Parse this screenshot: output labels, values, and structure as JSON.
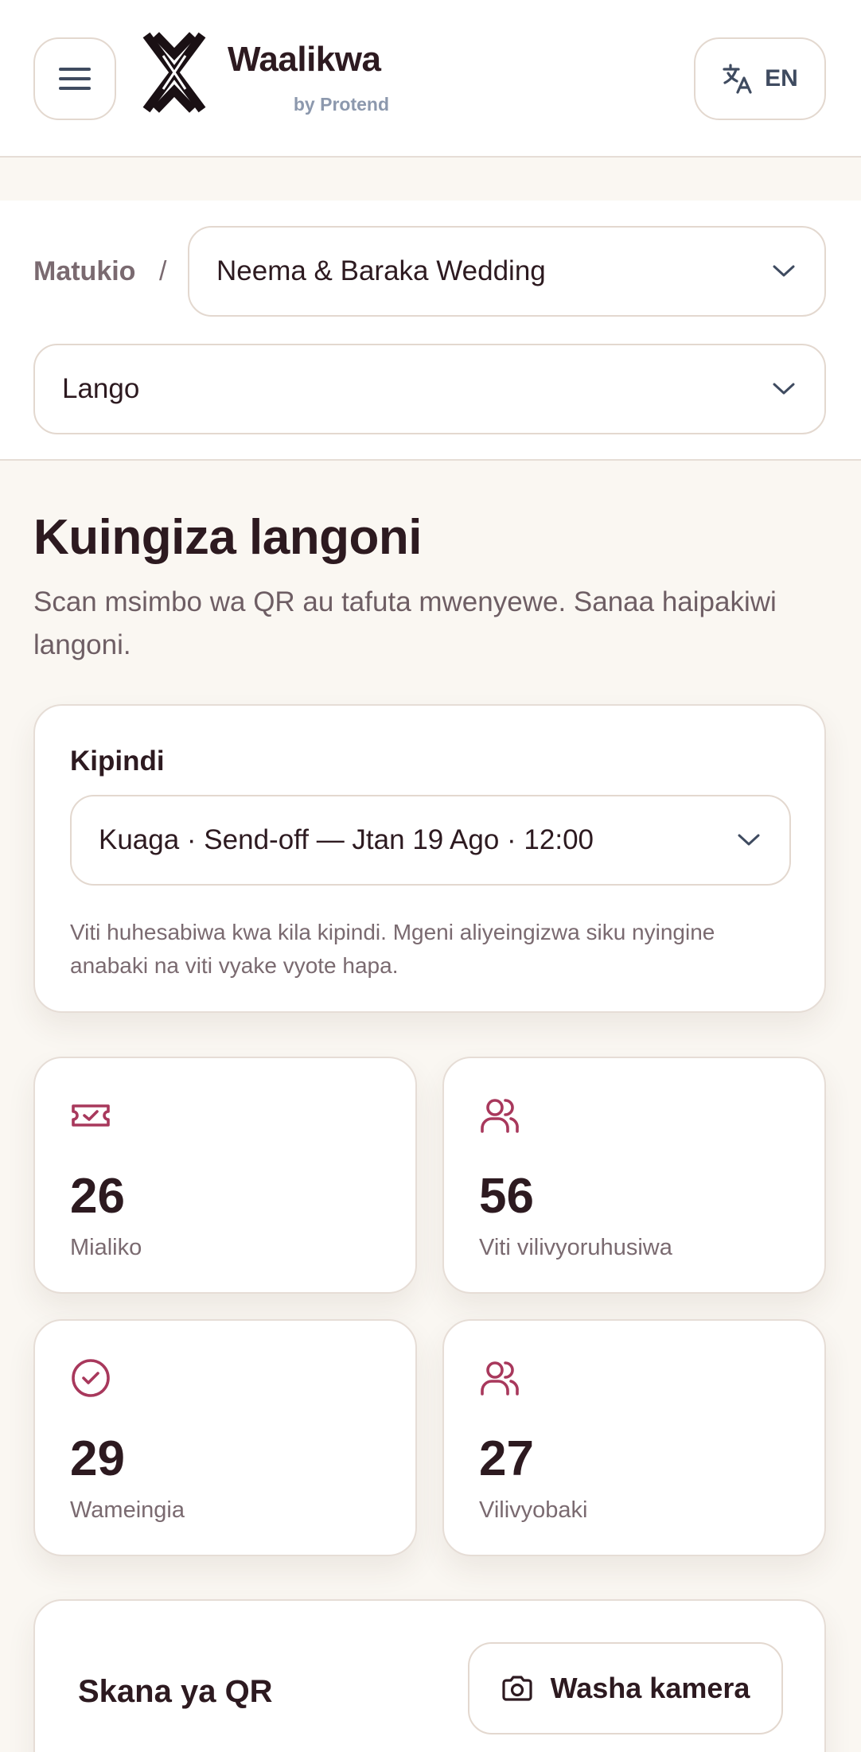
{
  "header": {
    "brand_name": "Waalikwa",
    "brand_by": "by Protend",
    "language": "EN"
  },
  "breadcrumb": {
    "root": "Matukio",
    "separator": "/"
  },
  "selectors": {
    "event": "Neema & Baraka Wedding",
    "gate": "Lango"
  },
  "page": {
    "title": "Kuingiza langoni",
    "subtitle": "Scan msimbo wa QR au tafuta mwenyewe. Sanaa haipakiwi langoni."
  },
  "session": {
    "label": "Kipindi",
    "selected": "Kuaga · Send-off — Jtan 19 Ago · 12:00",
    "note": "Viti huhesabiwa kwa kila kipindi. Mgeni aliyeingizwa siku nyingine anabaki na viti vyake vyote hapa."
  },
  "stats": [
    {
      "icon": "ticket-check-icon",
      "value": "26",
      "label": "Mialiko"
    },
    {
      "icon": "users-icon",
      "value": "56",
      "label": "Viti vilivyoruhusiwa"
    },
    {
      "icon": "check-circle-icon",
      "value": "29",
      "label": "Wameingia"
    },
    {
      "icon": "users-icon",
      "value": "27",
      "label": "Vilivyobaki"
    }
  ],
  "qr": {
    "title": "Skana ya QR",
    "camera_button": "Washa kamera"
  },
  "colors": {
    "accent": "#a8385c",
    "background": "#faf7f2",
    "text": "#2d1a20",
    "muted": "#7a6a70"
  }
}
